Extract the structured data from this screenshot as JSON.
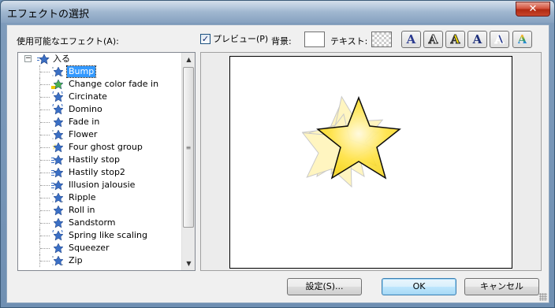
{
  "window": {
    "title": "エフェクトの選択",
    "close_glyph": "✕"
  },
  "left_panel": {
    "label": "使用可能なエフェクト(A):",
    "root": {
      "expander_glyph": "−",
      "label": "入る",
      "icon": "folder-star-icon"
    },
    "items": [
      {
        "label": "Bump",
        "icon": "sparkle-star-icon",
        "selected": true
      },
      {
        "label": "Change color fade in",
        "icon": "color-star-icon"
      },
      {
        "label": "Circinate",
        "icon": "rotate-star-icon"
      },
      {
        "label": "Domino",
        "icon": "rotate-star-icon"
      },
      {
        "label": "Fade in",
        "icon": "star-icon"
      },
      {
        "label": "Flower",
        "icon": "sparkle-star-icon"
      },
      {
        "label": "Four ghost group",
        "icon": "ghost-star-icon"
      },
      {
        "label": "Hastily stop",
        "icon": "motion-star-icon"
      },
      {
        "label": "Hastily stop2",
        "icon": "motion-star-icon"
      },
      {
        "label": "Illusion jalousie",
        "icon": "motion-star-icon"
      },
      {
        "label": "Ripple",
        "icon": "sparkle-star-icon"
      },
      {
        "label": "Roll in",
        "icon": "star-icon"
      },
      {
        "label": "Sandstorm",
        "icon": "star-icon"
      },
      {
        "label": "Spring like scaling",
        "icon": "rotate-star-icon"
      },
      {
        "label": "Squeezer",
        "icon": "star-icon"
      },
      {
        "label": "Zip",
        "icon": "sparkle-star-icon"
      }
    ],
    "scroll_up_glyph": "▲",
    "scroll_down_glyph": "▼",
    "scroll_grip_glyph": "≡"
  },
  "toolbar": {
    "preview_label": "プレビュー(P)",
    "preview_checked": true,
    "check_glyph": "✓",
    "background_label": "背景:",
    "background_color": "#ffffff",
    "text_label": "テキスト:",
    "style_buttons": [
      {
        "glyph": "A",
        "name": "style-blue-fill",
        "fill": "#2b3a8f",
        "stroke": "none"
      },
      {
        "glyph": "A",
        "name": "style-outline",
        "fill": "#ffffff",
        "stroke": "#333333"
      },
      {
        "glyph": "A",
        "name": "style-yellow",
        "fill": "#ffe600",
        "stroke": "#333333"
      },
      {
        "glyph": "A",
        "name": "style-dark-blue",
        "fill": "#1d2f7a",
        "stroke": "none"
      },
      {
        "glyph": "A",
        "name": "style-blue-outline",
        "fill": "#2c3e90",
        "stroke": "#ffffff"
      },
      {
        "glyph": "A",
        "name": "style-rainbow",
        "fill": "rainbow",
        "stroke": "none"
      }
    ]
  },
  "buttons": {
    "settings": "設定(S)...",
    "ok": "OK",
    "cancel": "キャンセル"
  },
  "colors": {
    "selection": "#3399ff",
    "star_fill": "#ffe44d",
    "star_outline": "#000000"
  }
}
